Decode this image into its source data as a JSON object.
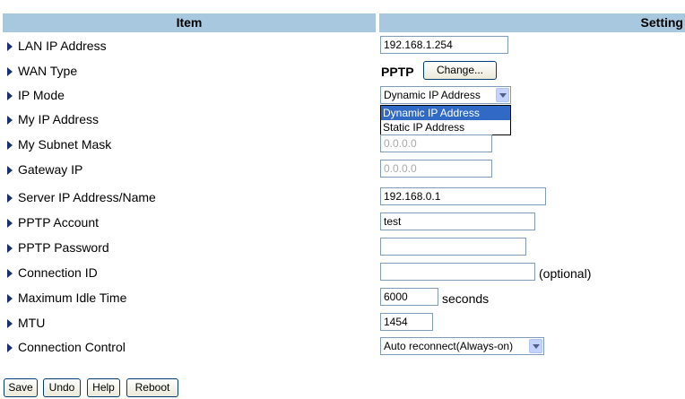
{
  "header": {
    "item": "Item",
    "setting": "Setting"
  },
  "rows": [
    {
      "label": "LAN IP Address"
    },
    {
      "label": "WAN Type"
    },
    {
      "label": "IP Mode"
    },
    {
      "label": "My IP Address"
    },
    {
      "label": "My Subnet Mask"
    },
    {
      "label": "Gateway IP"
    },
    {
      "label": "Server IP Address/Name"
    },
    {
      "label": "PPTP Account"
    },
    {
      "label": "PPTP Password"
    },
    {
      "label": "Connection ID"
    },
    {
      "label": "Maximum Idle Time"
    },
    {
      "label": "MTU"
    },
    {
      "label": "Connection Control"
    }
  ],
  "fields": {
    "lan_ip": "192.168.1.254",
    "wan_type": "PPTP",
    "change_button": "Change...",
    "ip_mode_selected": "Dynamic IP Address",
    "ip_mode_options": [
      "Dynamic IP Address",
      "Static IP Address"
    ],
    "my_subnet_mask": "0.0.0.0",
    "gateway_ip": "0.0.0.0",
    "server_ip": "192.168.0.1",
    "pptp_account": "test",
    "pptp_password": "",
    "connection_id": "",
    "connection_id_suffix": "(optional)",
    "max_idle_time": "6000",
    "max_idle_unit": "seconds",
    "mtu": "1454",
    "connection_control": "Auto reconnect(Always-on)"
  },
  "buttons": {
    "save": "Save",
    "undo": "Undo",
    "help": "Help",
    "reboot": "Reboot"
  },
  "colors": {
    "header_bg": "#a8c8e0",
    "highlight": "#316ac5",
    "bullet": "#1a2f6e"
  }
}
